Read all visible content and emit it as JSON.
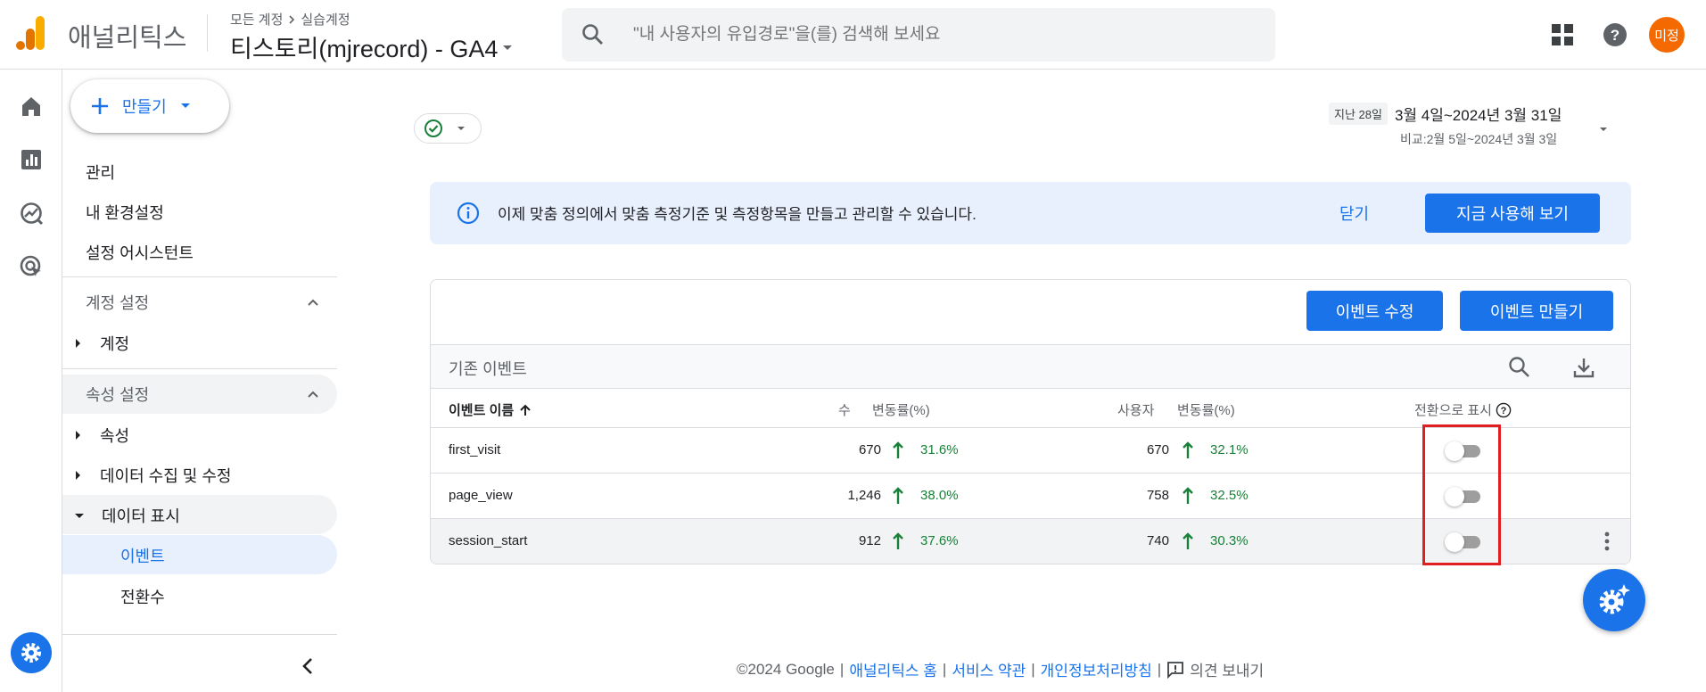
{
  "header": {
    "brand": "애널리틱스",
    "breadcrumb": [
      "모든 계정",
      "실습계정"
    ],
    "property": "티스토리(mjrecord) - GA4",
    "search_placeholder": "\"내 사용자의 유입경로\"을(를) 검색해 보세요",
    "avatar_text": "미정"
  },
  "nav": {
    "create_label": "만들기",
    "items": [
      "관리",
      "내 환경설정",
      "설정 어시스턴트"
    ],
    "account_section": "계정 설정",
    "account_sub": "계정",
    "property_section": "속성 설정",
    "property_subs": [
      "속성",
      "데이터 수집 및 수정",
      "데이터 표시"
    ],
    "data_display_children": [
      "이벤트",
      "전환수"
    ]
  },
  "date_range": {
    "preset": "지난 28일",
    "range": "3월 4일~2024년 3월 31일",
    "compare": "비교:2월 5일~2024년 3월 3일"
  },
  "banner": {
    "text": "이제 맞춤 정의에서 맞춤 측정기준 및 측정항목을 만들고 관리할 수 있습니다.",
    "close": "닫기",
    "action": "지금 사용해 보기"
  },
  "toolbar": {
    "edit_event": "이벤트 수정",
    "create_event": "이벤트 만들기"
  },
  "table": {
    "title": "기존 이벤트",
    "columns": {
      "name": "이벤트 이름",
      "count": "수",
      "count_change": "변동률(%)",
      "users": "사용자",
      "users_change": "변동률(%)",
      "conversion": "전환으로 표시"
    },
    "rows": [
      {
        "name": "first_visit",
        "count": "670",
        "count_change": "31.6%",
        "users": "670",
        "users_change": "32.1%"
      },
      {
        "name": "page_view",
        "count": "1,246",
        "count_change": "38.0%",
        "users": "758",
        "users_change": "32.5%"
      },
      {
        "name": "session_start",
        "count": "912",
        "count_change": "37.6%",
        "users": "740",
        "users_change": "30.3%"
      }
    ]
  },
  "footer": {
    "copyright": "©2024 Google",
    "links": [
      "애널리틱스 홈",
      "서비스 약관",
      "개인정보처리방침"
    ],
    "feedback": "의견 보내기"
  },
  "colors": {
    "accent": "#1a73e8",
    "positive": "#188038",
    "highlight": "#e02020",
    "avatar": "#f56a00"
  }
}
